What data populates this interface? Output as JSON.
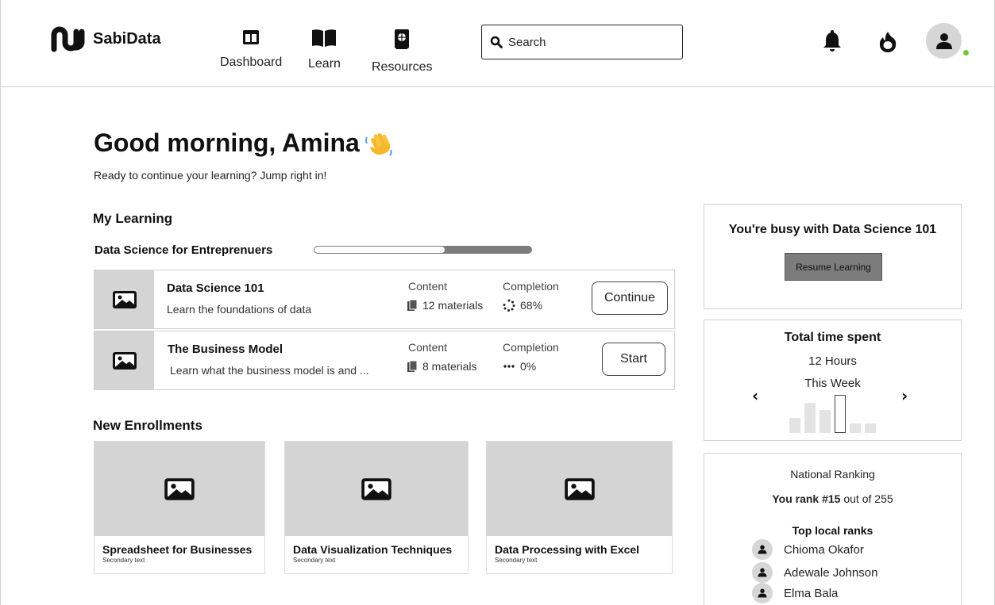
{
  "app": {
    "name": "SabiData"
  },
  "nav": [
    {
      "label": "Dashboard",
      "icon": "dashboard-icon"
    },
    {
      "label": "Learn",
      "icon": "book-icon"
    },
    {
      "label": "Resources",
      "icon": "resources-icon"
    }
  ],
  "search": {
    "placeholder": "Search"
  },
  "header_icons": [
    "bell-icon",
    "streak-flame-icon",
    "user-avatar-icon"
  ],
  "greeting": {
    "title": "Good morning, Amina",
    "subtitle": "Ready to continue your learning? Jump right in!"
  },
  "my_learning": {
    "heading": "My Learning",
    "path_title": "Data Science for Entreprenuers",
    "path_progress": 0.6,
    "courses": [
      {
        "title": "Data Science 101",
        "desc": "Learn the foundations of data",
        "content_label": "Content",
        "materials": "12 materials",
        "completion_label": "Completion",
        "completion": "68%",
        "button": "Continue"
      },
      {
        "title": "The Business Model",
        "desc": "Learn what the business model is and ...",
        "content_label": "Content",
        "materials": "8 materials",
        "completion_label": "Completion",
        "completion": "0%",
        "button": "Start"
      }
    ]
  },
  "new_enrollments": {
    "heading": "New Enrollments",
    "items": [
      {
        "title": "Spreadsheet for Businesses",
        "sub": "Secondary text"
      },
      {
        "title": "Data Visualization Techniques",
        "sub": "Secondary text"
      },
      {
        "title": "Data Processing with Excel",
        "sub": "Secondary text"
      }
    ]
  },
  "busy": {
    "title": "You're busy with Data Science 101",
    "button": "Resume Learning"
  },
  "time_spent": {
    "title": "Total time spent",
    "value": "12 Hours",
    "period": "This Week",
    "prev": "‹",
    "next": "›",
    "bars": [
      0.4,
      0.8,
      0.6,
      1.0,
      0.25,
      0.25
    ],
    "selected_index": 3
  },
  "ranking": {
    "title": "National Ranking",
    "rank_bold": "You rank #15",
    "rank_rest": "out of 255",
    "top_title": "Top local ranks",
    "people": [
      "Chioma Okafor",
      "Adewale Johnson",
      "Elma Bala"
    ]
  },
  "colors": {
    "accent_gray": "#7c7c7c",
    "placeholder_gray": "#d4d4d4",
    "online": "#72c43c"
  }
}
